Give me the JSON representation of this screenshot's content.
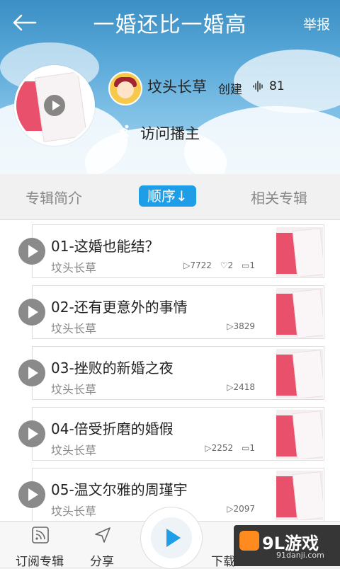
{
  "header": {
    "title": "一婚还比一婚高",
    "report_label": "举报"
  },
  "album": {
    "author": "坟头长草",
    "created_label": "创建",
    "fans_count": "81",
    "visit_label": "访问播主"
  },
  "tabs": [
    {
      "label": "专辑简介"
    },
    {
      "label": "顺序↓"
    },
    {
      "label": "相关专辑"
    }
  ],
  "tracks": [
    {
      "title": "01-这婚也能结？",
      "author": "坟头长草",
      "plays": "7722",
      "likes": "2",
      "comments": "1"
    },
    {
      "title": "02-还有更意外的事情",
      "author": "坟头长草",
      "plays": "3829"
    },
    {
      "title": "03-挫败的新婚之夜",
      "author": "坟头长草",
      "plays": "2418"
    },
    {
      "title": "04-倍受折磨的婚假",
      "author": "坟头长草",
      "plays": "2252",
      "comments": "1"
    },
    {
      "title": "05-温文尔雅的周瑾宇",
      "author": "坟头长草",
      "plays": "2097"
    }
  ],
  "bottombar": {
    "subscribe_label": "订阅专辑",
    "share_label": "分享",
    "download_label": "下载"
  },
  "watermark": {
    "brand": "9L游戏",
    "site": "91danji.com"
  },
  "colors": {
    "accent": "#1e9ee6",
    "cover_pink": "#e9506c"
  }
}
